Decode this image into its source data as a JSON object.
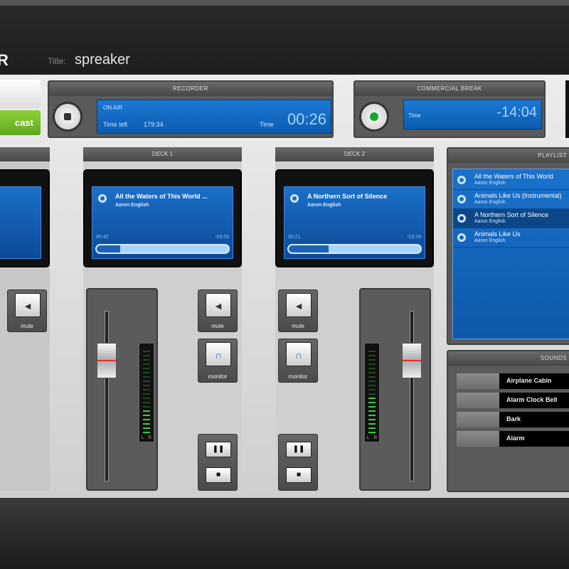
{
  "header": {
    "logo": "R",
    "title_label": "Title:",
    "title_value": "spreaker"
  },
  "left": {
    "broadcast_label": "cast"
  },
  "recorder": {
    "title": "RECORDER",
    "status": "ON AIR",
    "time_left_label": "Time left",
    "time_left": "179:34",
    "time_label": "Time",
    "time": "00:26"
  },
  "commercial": {
    "title": "COMMERCIAL BREAK",
    "time_label": "Time",
    "time": "-14:04"
  },
  "decks": [
    {
      "title": "DECK 1",
      "track": "All the Waters of This World ...",
      "artist": "Aaron English",
      "elapsed": "00:42",
      "remaining": "-03:55",
      "progress": 0.18,
      "mute": "mute",
      "monitor": "monitor"
    },
    {
      "title": "DECK 2",
      "track": "A Northern Sort of Silence",
      "artist": "Aaron English",
      "elapsed": "00:21",
      "remaining": "-03:29",
      "progress": 0.3,
      "mute": "mute",
      "monitor": "monitor"
    }
  ],
  "deck0": {
    "mute": "mute"
  },
  "playlist": {
    "title": "PLAYLIST",
    "items": [
      {
        "title": "All the Waters of This World",
        "artist": "Aaron English"
      },
      {
        "title": "Animals Like Us (Instrumental)",
        "artist": "Aaron English"
      },
      {
        "title": "A Northern Sort of Silence",
        "artist": "Aaron English"
      },
      {
        "title": "Animals Like Us",
        "artist": "Aaron English"
      }
    ]
  },
  "sounds": {
    "title": "SOUNDS",
    "items": [
      "Airplane Cabin",
      "Alarm Clock Bell",
      "Bark",
      "Alarm"
    ]
  },
  "meter": {
    "left": "L",
    "right": "R"
  }
}
